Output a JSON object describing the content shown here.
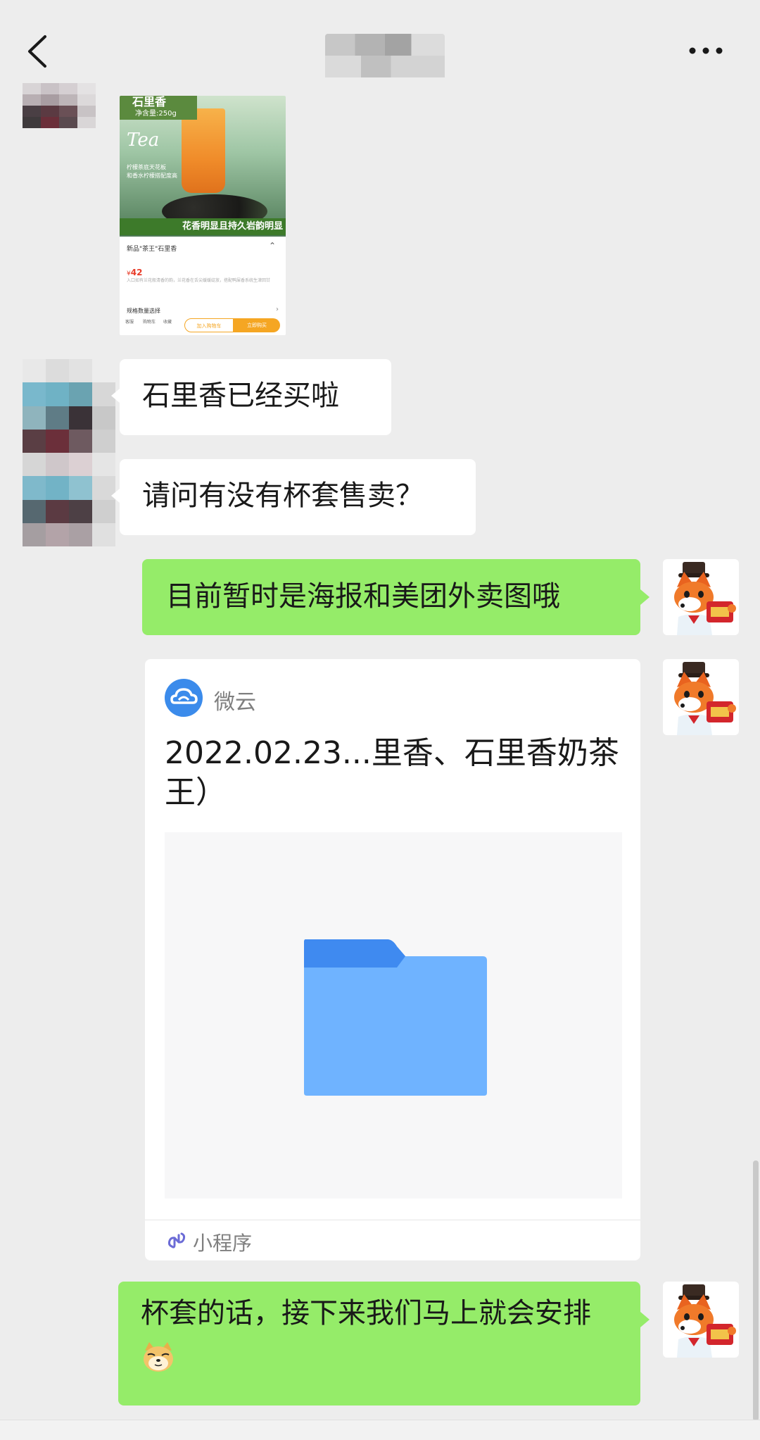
{
  "header": {
    "title_blurred": true
  },
  "product_image": {
    "title": "石里香",
    "net_weight": "净含量:250g",
    "tea_label": "Tea",
    "desc_line1": "柠檬茶底天花板",
    "desc_line2": "和香水柠檬搭配度高",
    "banner": "花香明显且持久岩韵明显",
    "product_name": "新品\"茶王\"石里香",
    "price_symbol": "¥",
    "price": "42",
    "note": "入口如有兰花般清香的韵，兰花香在舌尖缓缓绽放，搭配鸭屎香系统生津回甘",
    "spec_label": "规格数量选择",
    "nav": [
      "客服",
      "购物车",
      "收藏"
    ],
    "add_cart": "加入购物车",
    "buy_now": "立即购买"
  },
  "messages": [
    {
      "side": "left",
      "text": "石里香已经买啦"
    },
    {
      "side": "left",
      "text": "请问有没有杯套售卖？"
    },
    {
      "side": "right",
      "text": "目前暂时是海报和美团外卖图哦"
    },
    {
      "side": "right",
      "text": "杯套的话，接下来我们马上就会安排"
    }
  ],
  "mini_program_card": {
    "source": "微云",
    "title": "2022.02.23...里香、石里香奶茶王）",
    "footer_label": "小程序",
    "preview_icon": "folder-icon"
  },
  "colors": {
    "background": "#ededed",
    "self_bubble": "#95ec69",
    "other_bubble": "#ffffff",
    "weiyun_blue": "#3b8beb"
  }
}
